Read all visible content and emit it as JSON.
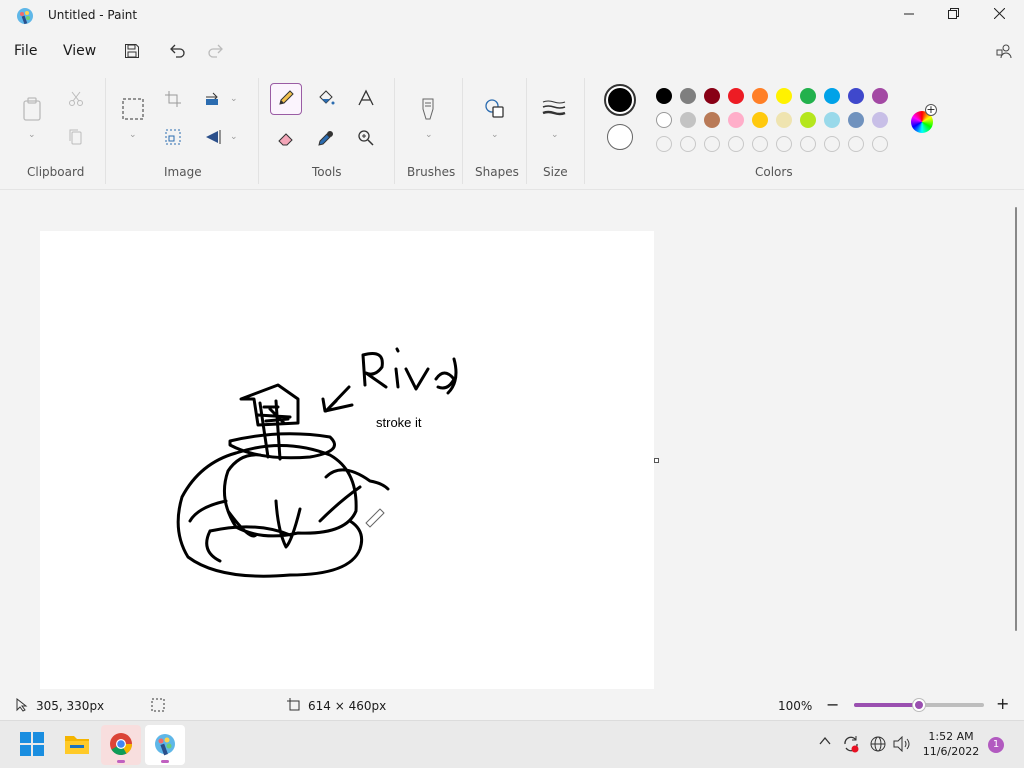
{
  "window": {
    "title": "Untitled - Paint"
  },
  "menu": {
    "file": "File",
    "view": "View"
  },
  "ribbon": {
    "groups": {
      "clipboard": "Clipboard",
      "image": "Image",
      "tools": "Tools",
      "brushes": "Brushes",
      "shapes": "Shapes",
      "size": "Size",
      "colors": "Colors"
    },
    "selected_tool": "pencil",
    "primary_color": "#000000",
    "secondary_color": "#ffffff",
    "palette": [
      "#000000",
      "#7f7f7f",
      "#880015",
      "#ed1c24",
      "#ff7f27",
      "#fff200",
      "#22b14c",
      "#00a2e8",
      "#3f48cc",
      "#a349a4",
      "#ffffff",
      "#c3c3c3",
      "#b97a57",
      "#ffaec9",
      "#ffc90e",
      "#efe4b0",
      "#b5e61d",
      "#99d9ea",
      "#7092be",
      "#c8bfe7"
    ]
  },
  "canvas": {
    "texts": {
      "label_1": "",
      "label_2": "stroke it"
    },
    "handwriting": "Riva"
  },
  "status": {
    "cursor_position": "305, 330px",
    "canvas_size": "614 × 460px",
    "zoom": "100%",
    "zoom_slider_percent": 50
  },
  "taskbar": {
    "apps": [
      "windows-start",
      "file-explorer",
      "chrome",
      "paint"
    ],
    "time": "1:52 AM",
    "date": "11/6/2022",
    "notification_count": "1"
  }
}
